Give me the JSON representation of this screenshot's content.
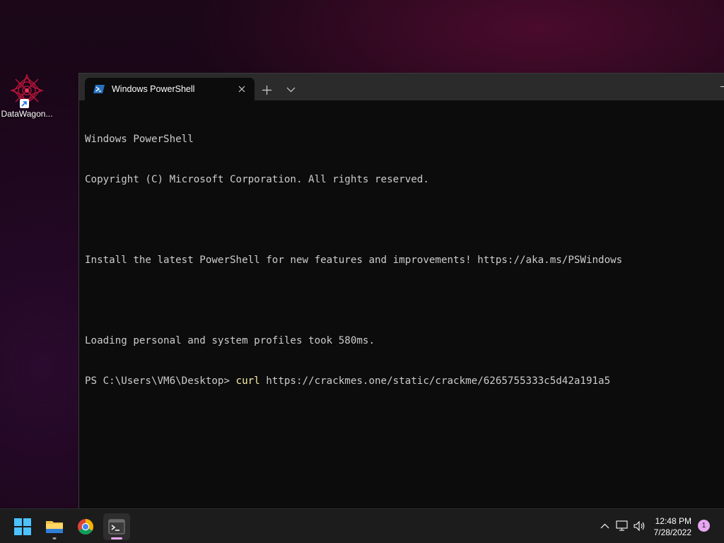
{
  "desktop": {
    "icon_label": "DataWagon..."
  },
  "window": {
    "tab_title": "Windows PowerShell"
  },
  "terminal": {
    "lines": [
      "Windows PowerShell",
      "Copyright (C) Microsoft Corporation. All rights reserved.",
      "",
      "Install the latest PowerShell for new features and improvements! https://aka.ms/PSWindows",
      "",
      "Loading personal and system profiles took 580ms."
    ],
    "prompt": "PS C:\\Users\\VM6\\Desktop> ",
    "command": "curl",
    "argument": " https://crackmes.one/static/crackme/6265755333c5d42a191a5"
  },
  "taskbar": {
    "apps": [
      "start-icon",
      "file-explorer-icon",
      "chrome-icon",
      "terminal-icon"
    ],
    "clock_time": "12:48 PM",
    "clock_date": "7/28/2022",
    "notification_count": "1"
  },
  "colors": {
    "terminal_bg": "#0c0c0c",
    "terminal_fg": "#cccccc",
    "command_fg": "#f9f1a5",
    "taskbar_bg": "#1c1c1c"
  }
}
